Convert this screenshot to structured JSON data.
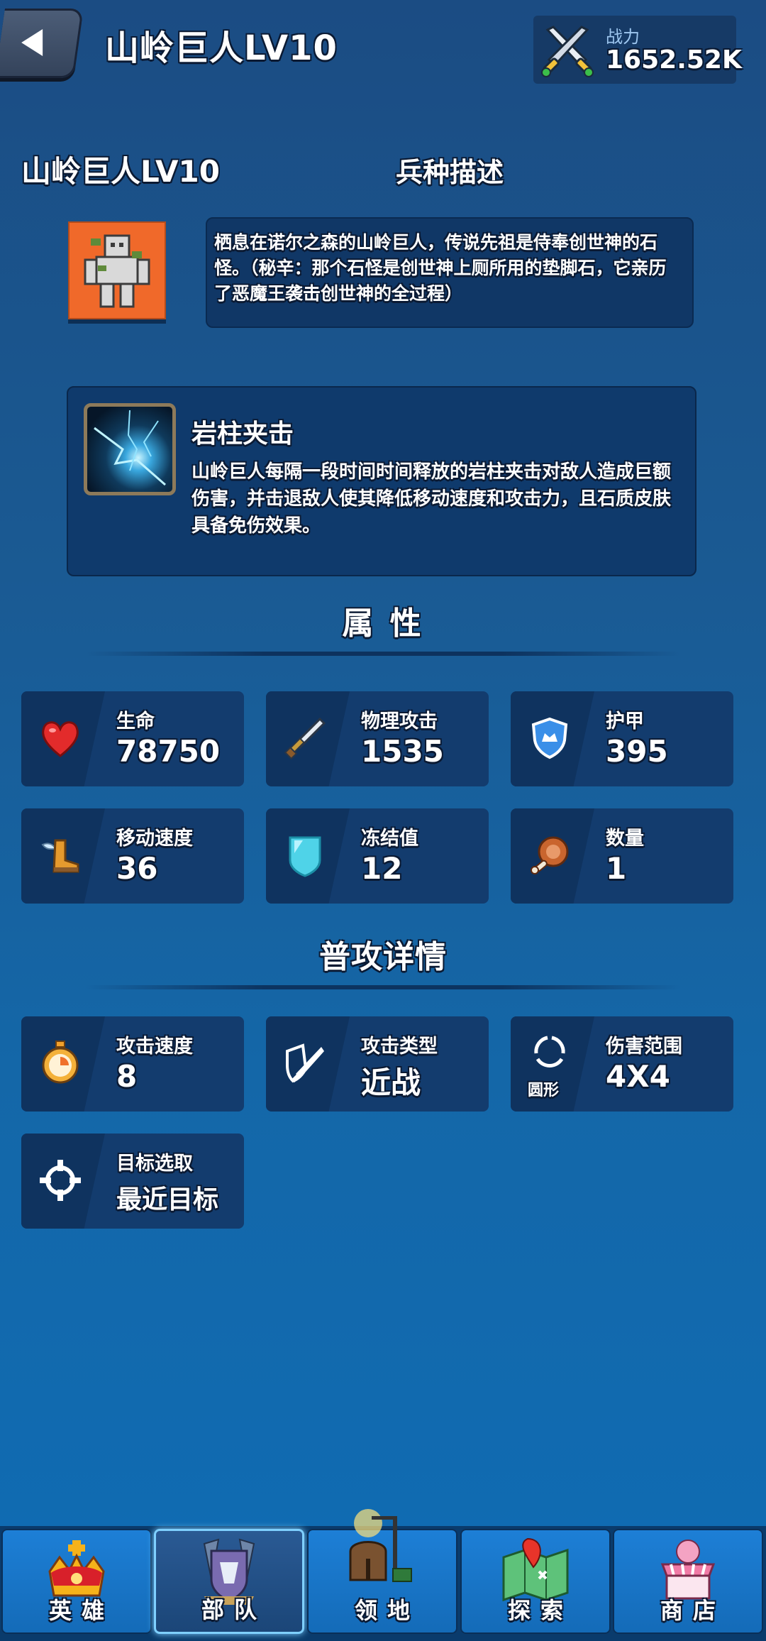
{
  "header": {
    "title": "山岭巨人LV10",
    "power_label": "战力",
    "power_value": "1652.52K"
  },
  "unit": {
    "name": "山岭巨人LV10",
    "description_heading": "兵种描述",
    "description": "栖息在诺尔之森的山岭巨人，传说先祖是侍奉创世神的石怪。（秘辛：那个石怪是创世神上厕所用的垫脚石，它亲历了恶魔王袭击创世神的全过程）"
  },
  "skill": {
    "name": "岩柱夹击",
    "description": "山岭巨人每隔一段时间时间释放的岩柱夹击对敌人造成巨额伤害，并击退敌人使其降低移动速度和攻击力，且石质皮肤具备免伤效果。"
  },
  "attributes": {
    "title": "属 性",
    "items": [
      {
        "label": "生命",
        "value": "78750",
        "icon": "heart-icon"
      },
      {
        "label": "物理攻击",
        "value": "1535",
        "icon": "sword-icon"
      },
      {
        "label": "护甲",
        "value": "395",
        "icon": "shield-icon"
      },
      {
        "label": "移动速度",
        "value": "36",
        "icon": "winged-boot-icon"
      },
      {
        "label": "冻结值",
        "value": "12",
        "icon": "ice-shield-icon"
      },
      {
        "label": "数量",
        "value": "1",
        "icon": "meat-icon"
      }
    ]
  },
  "attack": {
    "title": "普攻详情",
    "items": [
      {
        "label": "攻击速度",
        "value": "8",
        "icon": "stopwatch-icon"
      },
      {
        "label": "攻击类型",
        "value": "近战",
        "icon": "melee-icon"
      },
      {
        "label": "伤害范围",
        "value": "4X4",
        "icon": "circle-range-icon",
        "icon_caption": "圆形"
      },
      {
        "label": "目标选取",
        "value": "最近目标",
        "icon": "crosshair-icon"
      }
    ]
  },
  "nav": {
    "items": [
      {
        "label": "英雄",
        "icon": "crown-icon",
        "active": false
      },
      {
        "label": "部队",
        "icon": "troop-emblem-icon",
        "active": true
      },
      {
        "label": "领地",
        "icon": "territory-icon",
        "active": false
      },
      {
        "label": "探索",
        "icon": "map-icon",
        "active": false
      },
      {
        "label": "商店",
        "icon": "shop-icon",
        "active": false
      }
    ]
  },
  "colors": {
    "background": "#1a5a93",
    "card": "#133c6e",
    "active_nav_glow": "#7fd0ff",
    "portrait_bg": "#f0692a"
  }
}
